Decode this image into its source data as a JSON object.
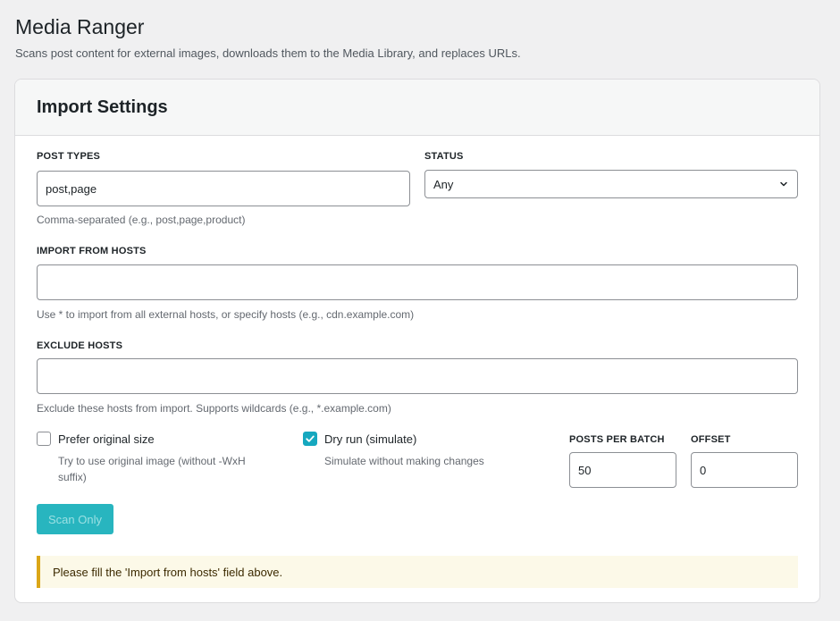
{
  "header": {
    "title": "Media Ranger",
    "description": "Scans post content for external images, downloads them to the Media Library, and replaces URLs."
  },
  "card": {
    "title": "Import Settings"
  },
  "post_types": {
    "label": "POST TYPES",
    "value": "post,page",
    "help": "Comma-separated (e.g., post,page,product)"
  },
  "status": {
    "label": "STATUS",
    "selected": "Any"
  },
  "import_hosts": {
    "label": "IMPORT FROM HOSTS",
    "value": "",
    "help": "Use * to import from all external hosts, or specify hosts (e.g., cdn.example.com)"
  },
  "exclude_hosts": {
    "label": "EXCLUDE HOSTS",
    "value": "",
    "help": "Exclude these hosts from import. Supports wildcards (e.g., *.example.com)"
  },
  "prefer_original": {
    "label": "Prefer original size",
    "checked": false,
    "help": "Try to use original image (without -WxH suffix)"
  },
  "dry_run": {
    "label": "Dry run (simulate)",
    "checked": true,
    "help": "Simulate without making changes"
  },
  "posts_per_batch": {
    "label": "POSTS PER BATCH",
    "value": "50"
  },
  "offset": {
    "label": "OFFSET",
    "value": "0"
  },
  "actions": {
    "scan_label": "Scan Only",
    "scan_disabled": true
  },
  "notice": {
    "text": "Please fill the 'Import from hosts' field above."
  },
  "colors": {
    "accent": "#16a8bf",
    "button": "#28b5bf",
    "notice_border": "#dba617",
    "notice_bg": "#fcf9e8"
  },
  "icons": {
    "status_select": "chevron-down-icon",
    "dry_run_checkbox": "checkmark-icon"
  }
}
